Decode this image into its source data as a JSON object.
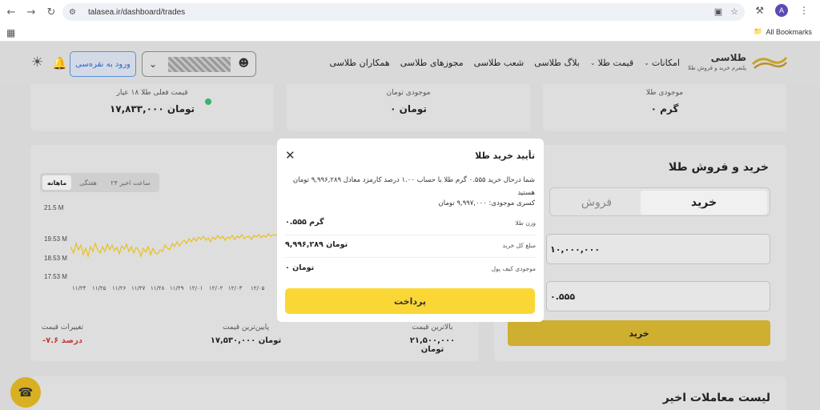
{
  "browser": {
    "url": "talasea.ir/dashboard/trades",
    "profile_initial": "A",
    "all_bookmarks": "All Bookmarks"
  },
  "header": {
    "logo_name": "طلاسی",
    "logo_sub": "پلتفرم خرید و فروش طلا",
    "nav": [
      {
        "label": "امکانات",
        "dropdown": true
      },
      {
        "label": "قیمت طلا",
        "dropdown": true
      },
      {
        "label": "بلاگ طلاسی",
        "dropdown": false
      },
      {
        "label": "شعب طلاسی",
        "dropdown": false
      },
      {
        "label": "مجوزهای طلاسی",
        "dropdown": false
      },
      {
        "label": "همکاران طلاسی",
        "dropdown": false
      }
    ],
    "login_button": "ورود به نقره‌سی"
  },
  "stats": {
    "gold_balance_label": "موجودی طلا",
    "gold_balance_value": "۰ گرم",
    "toman_balance_label": "موجودی تومان",
    "toman_balance_value": "۰ تومان",
    "gold_price_label": "قیمت فعلی طلا ۱۸ عیار",
    "gold_price_value": "۱۷,۸۳۳,۰۰۰ تومان"
  },
  "trade": {
    "title": "خرید و فروش طلا",
    "tab_buy": "خرید",
    "tab_sell": "فروش",
    "amount_value": "۱۰,۰۰۰,۰۰۰",
    "weight_value": "۰.۵۵۵",
    "buy_button": "خرید"
  },
  "chart": {
    "tabs": [
      "ماهانه",
      "هفتگی",
      "۲۴ ساعت اخیر"
    ],
    "active_tab": "ماهانه",
    "y_ticks": [
      "21.5 M",
      "19.53 M",
      "18.53 M",
      "17.53 M"
    ],
    "x_ticks": [
      "۱۱/۲۴",
      "۱۱/۲۵",
      "۱۱/۲۶",
      "۱۱/۲۷",
      "۱۱/۲۸",
      "۱۱/۲۹",
      "۱۲/۰۱",
      "۱۲/۰۲",
      "۱۲/۰۳",
      "۱۲/۰۵"
    ],
    "line_color": "#e8c020",
    "summary": {
      "max_label": "بالاترین قیمت",
      "max_value": "۲۱,۵۰۰,۰۰۰ تومان",
      "min_label": "پایین‌ترین قیمت",
      "min_value": "۱۷,۵۳۰,۰۰۰ تومان",
      "change_label": "تغییرات قیمت",
      "change_value": "-۷.۶ درصد"
    }
  },
  "recent": {
    "title": "لیست معاملات اخیر"
  },
  "modal": {
    "title": "تأیید خرید طلا",
    "description": "شما درحال خرید ۰.۵۵۵ گرم طلا با حساب ۱.۰۰ درصد کارمزد معادل ۹,۹۹۶,۲۸۹ تومان هستید",
    "deduction": "کسری موجودی: ۹,۹۹۷,۰۰۰ تومان",
    "rows": [
      {
        "label": "وزن طلا",
        "value": "۰.۵۵۵ گرم"
      },
      {
        "label": "مبلغ کل خرید",
        "value": "۹,۹۹۶,۲۸۹ تومان"
      },
      {
        "label": "موجودی کیف پول",
        "value": "۰ تومان"
      }
    ],
    "pay_button": "پرداخت"
  },
  "colors": {
    "accent_yellow": "#fbd736",
    "buy_button": "#cfaf2f",
    "negative": "#c43b3b",
    "online_dot": "#3bb36a"
  }
}
